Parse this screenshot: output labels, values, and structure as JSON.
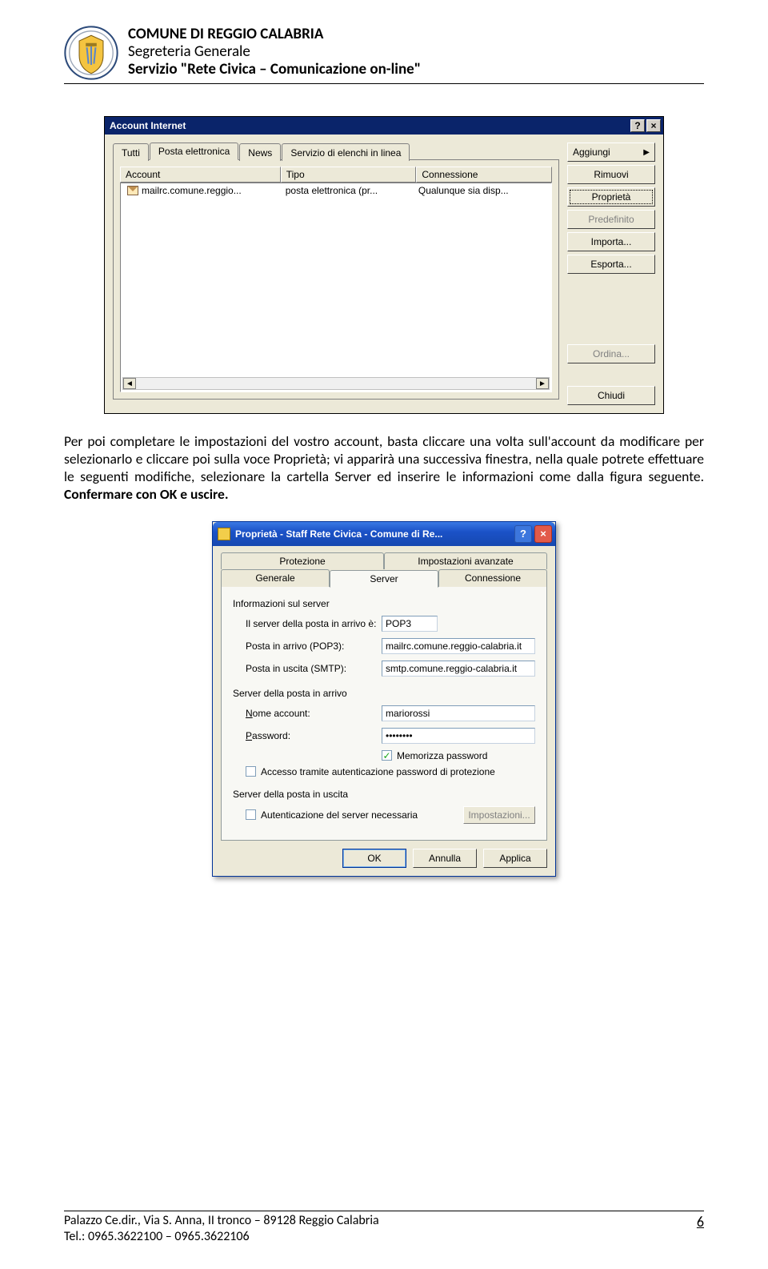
{
  "header": {
    "line1": "COMUNE DI REGGIO CALABRIA",
    "line2": "Segreteria Generale",
    "line3": "Servizio \"Rete Civica – Comunicazione on-line\""
  },
  "dlg1": {
    "title": "Account Internet",
    "help_btn": "?",
    "close_btn": "×",
    "tabs": {
      "tutti": "Tutti",
      "posta": "Posta elettronica",
      "news": "News",
      "servizio": "Servizio di elenchi in linea"
    },
    "columns": {
      "account": "Account",
      "tipo": "Tipo",
      "conn": "Connessione"
    },
    "row": {
      "account": "mailrc.comune.reggio...",
      "tipo": "posta elettronica (pr...",
      "conn": "Qualunque sia disp..."
    },
    "buttons": {
      "aggiungi": "Aggiungi",
      "rimuovi": "Rimuovi",
      "proprieta": "Proprietà",
      "predefinito": "Predefinito",
      "importa": "Importa...",
      "esporta": "Esporta...",
      "ordina": "Ordina...",
      "chiudi": "Chiudi"
    }
  },
  "para_before": "Per poi completare le impostazioni del vostro account, basta cliccare una volta sull'account da modificare per selezionarlo e cliccare poi sulla voce Proprietà; vi apparirà una successiva finestra, nella quale potrete effettuare le seguenti modifiche, selezionare la cartella Server ed inserire le informazioni come dalla figura seguente. ",
  "para_bold": "Confermare con OK e uscire.",
  "dlg2": {
    "title": "Proprietà - Staff Rete Civica - Comune di Re...",
    "help_btn": "?",
    "close_btn": "×",
    "tabs": {
      "protezione": "Protezione",
      "avanzate": "Impostazioni avanzate",
      "generale": "Generale",
      "server": "Server",
      "connessione": "Connessione"
    },
    "grp_info": "Informazioni sul server",
    "server_type_label": "Il server della posta in arrivo è:",
    "server_type_value": "POP3",
    "pop_label": "Posta in arrivo (POP3):",
    "pop_value": "mailrc.comune.reggio-calabria.it",
    "smtp_label": "Posta in uscita (SMTP):",
    "smtp_value": "smtp.comune.reggio-calabria.it",
    "grp_in": "Server della posta in arrivo",
    "user_label": "Nome account:",
    "user_value": "mariorossi",
    "pass_label": "Password:",
    "pass_value": "••••••••",
    "chk_mem": "Memorizza password",
    "chk_auth": "Accesso tramite autenticazione password di protezione",
    "grp_out": "Server della posta in uscita",
    "chk_outauth": "Autenticazione del server necessaria",
    "imp_btn": "Impostazioni...",
    "ok": "OK",
    "annulla": "Annulla",
    "applica": "Applica"
  },
  "footer": {
    "addr": "Palazzo Ce.dir., Via S. Anna, II tronco – 89128 Reggio Calabria",
    "tel": "Tel.: 0965.3622100 – 0965.3622106",
    "page": "6"
  }
}
